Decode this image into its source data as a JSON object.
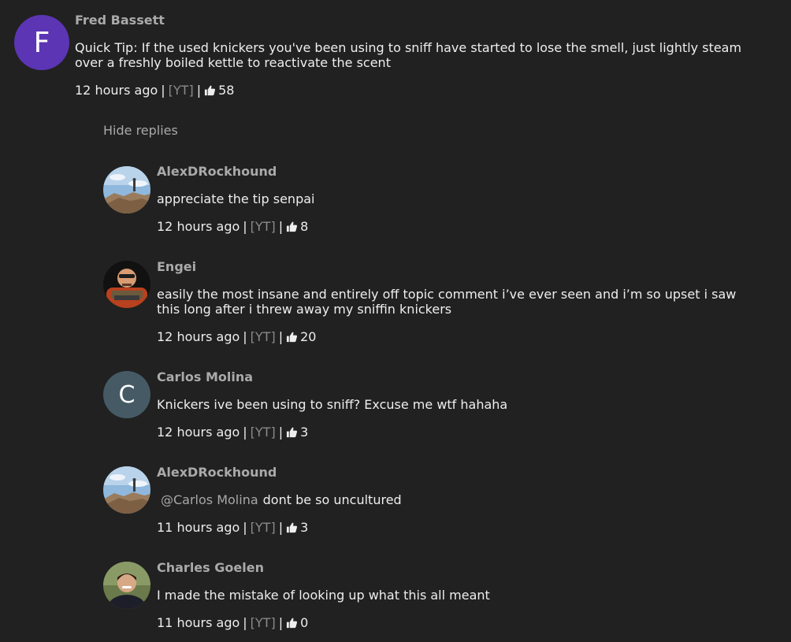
{
  "top_comment": {
    "avatar_letter": "F",
    "avatar_color": "#5c35b5",
    "author": "Fred Bassett",
    "text": "Quick Tip: If the used knickers you've been using to sniff have started to lose the smell, just lightly steam over a freshly boiled kettle to reactivate the scent",
    "time": "12 hours ago",
    "source": "[YT]",
    "likes": "58"
  },
  "hide_replies_label": "Hide replies",
  "separator": "|",
  "replies": [
    {
      "author": "AlexDRockhound",
      "avatar": "landscape-photo",
      "text": "appreciate the tip senpai",
      "time": "12 hours ago",
      "source": "[YT]",
      "likes": "8"
    },
    {
      "author": "Engei",
      "avatar": "character-portrait",
      "text": "easily the most insane and entirely off topic comment i’ve ever seen and i’m so upset i saw this long after i threw away my sniffin knickers",
      "time": "12 hours ago",
      "source": "[YT]",
      "likes": "20"
    },
    {
      "author": "Carlos Molina",
      "avatar_letter": "C",
      "avatar_color": "#455a64",
      "text": "Knickers ive been using to sniff? Excuse me wtf hahaha",
      "time": "12 hours ago",
      "source": "[YT]",
      "likes": "3"
    },
    {
      "author": "AlexDRockhound",
      "avatar": "landscape-photo",
      "mention": "@Carlos Molina",
      "text": "dont be so uncultured",
      "time": "11 hours ago",
      "source": "[YT]",
      "likes": "3"
    },
    {
      "author": "Charles Goelen",
      "avatar": "person-photo",
      "text": "I made the mistake of looking up what this all meant",
      "time": "11 hours ago",
      "source": "[YT]",
      "likes": "0"
    }
  ]
}
